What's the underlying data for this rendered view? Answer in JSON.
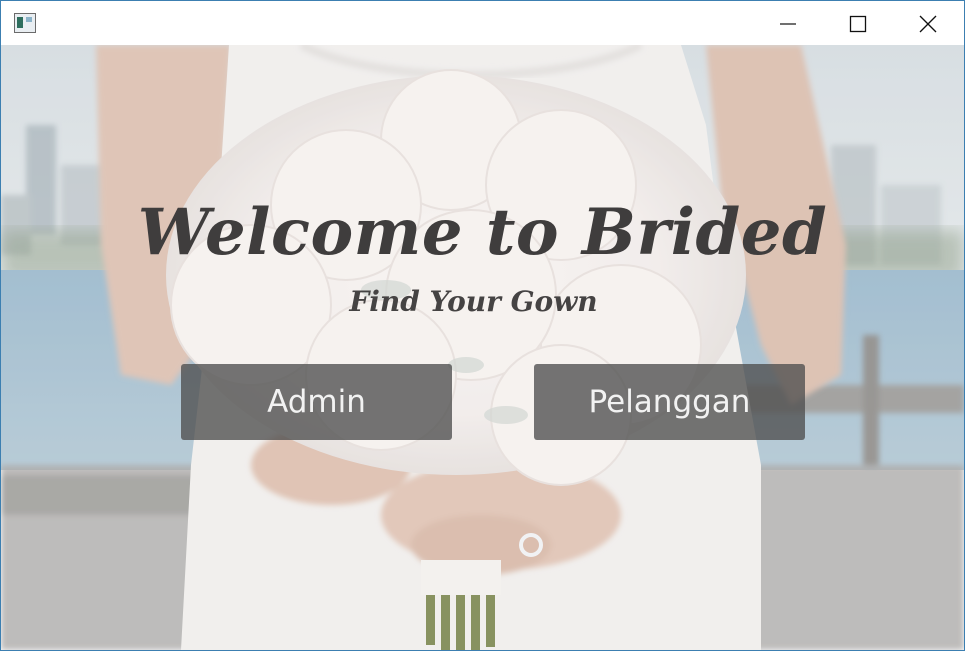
{
  "window": {
    "controls": [
      "minimize-icon",
      "maximize-icon",
      "close-icon"
    ]
  },
  "hero": {
    "title": "Welcome to Brided",
    "subtitle": "Find Your Gown"
  },
  "buttons": {
    "admin_label": "Admin",
    "pelanggan_label": "Pelanggan"
  },
  "colors": {
    "button_bg": "#4e4e4e",
    "button_text": "#f2f2f2",
    "title_text": "#3f3d3d",
    "window_border": "#3c7fb1"
  }
}
